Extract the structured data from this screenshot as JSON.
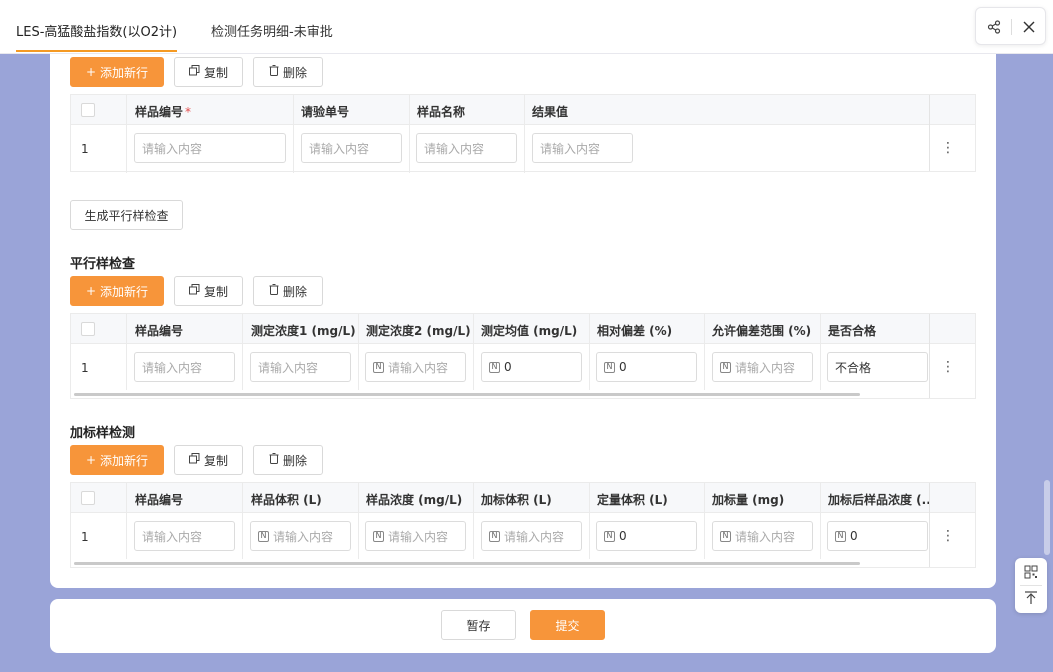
{
  "tabs": [
    {
      "label": "LES-高猛酸盐指数(以O2计)",
      "active": true
    },
    {
      "label": "检测任务明细-未审批",
      "active": false
    }
  ],
  "toolbar": {
    "add_label": "添加新行",
    "copy_label": "复制",
    "delete_label": "删除"
  },
  "placeholder": "请输入内容",
  "table1": {
    "headers": [
      "样品编号",
      "请验单号",
      "样品名称",
      "结果值"
    ],
    "required_mark": "*",
    "row_num": "1"
  },
  "generate_button": "生成平行样检查",
  "section2": {
    "title": "平行样检查",
    "headers": [
      "样品编号",
      "测定浓度1 (mg/L)",
      "测定浓度2 (mg/L)",
      "测定均值 (mg/L)",
      "相对偏差 (%)",
      "允许偏差范围 (%)",
      "是否合格"
    ],
    "row_num": "1",
    "values": {
      "mean": "0",
      "rel_dev": "0",
      "qualified": "不合格"
    }
  },
  "section3": {
    "title": "加标样检测",
    "headers": [
      "样品编号",
      "样品体积 (L)",
      "样品浓度 (mg/L)",
      "加标体积 (L)",
      "定量体积 (L)",
      "加标量 (mg)",
      "加标后样品浓度 (..."
    ],
    "row_num": "1",
    "values": {
      "fixed_volume": "0",
      "after_conc": "0"
    }
  },
  "footer": {
    "save_label": "暂存",
    "submit_label": "提交"
  },
  "icons": {
    "n_badge": "N"
  },
  "colors": {
    "accent": "#f7953a",
    "background": "#9aa4d8"
  }
}
